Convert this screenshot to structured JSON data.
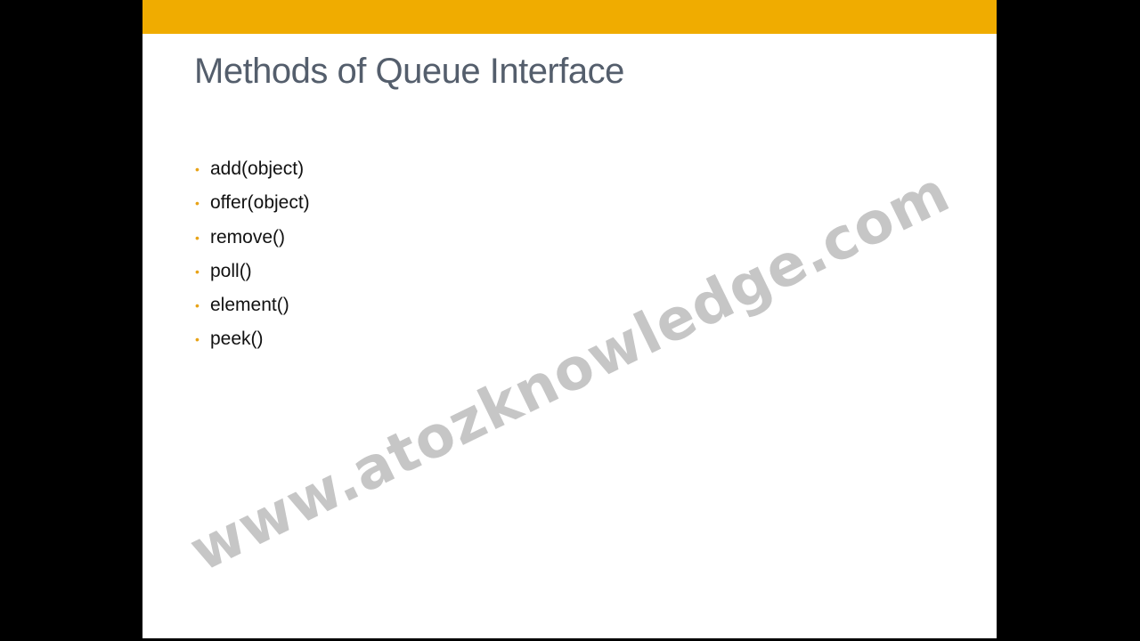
{
  "slide": {
    "title": "Methods of Queue Interface",
    "accent_color": "#f0ac00",
    "bullet_color": "#e8a317",
    "bullet_symbol": "•",
    "items": [
      "add(object)",
      "offer(object)",
      "remove()",
      "poll()",
      "element()",
      "peek()"
    ]
  },
  "watermark": {
    "text": "www.atozknowledge.com"
  }
}
